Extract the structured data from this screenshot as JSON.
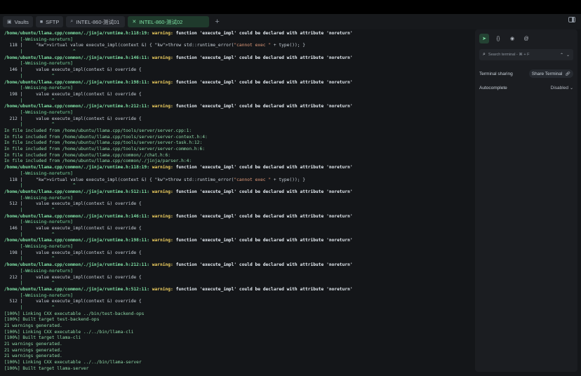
{
  "tabs": [
    {
      "icon": "vault-icon",
      "glyph": "▣",
      "label": "Vaults",
      "active": false
    },
    {
      "icon": "folder-icon",
      "glyph": "■",
      "label": "SFTP",
      "active": false
    },
    {
      "icon": "terminal-icon",
      "glyph": "⌕",
      "label": "INTEL-860-测试01",
      "active": false
    },
    {
      "icon": "close-icon",
      "glyph": "✕",
      "label": "INTEL-860-测试02",
      "active": true
    }
  ],
  "new_tab_label": "+",
  "terminal_lines": [
    {
      "type": "path",
      "pre": "/home/ubuntu/llama.cpp/common/./jinja/runtime.h:118:19: ",
      "warn": "warning:",
      "msg": " function 'execute_impl' could be declared with attribute 'noreturn'"
    },
    {
      "type": "flag",
      "text": "      [-Wmissing-noreturn]"
    },
    {
      "type": "code",
      "text": "  118 |     virtual value execute_impl(context &) { throw std::runtime_error(\"cannot exec \" + type()); }"
    },
    {
      "type": "caret",
      "text": "      |                   ^"
    },
    {
      "type": "path",
      "pre": "/home/ubuntu/llama.cpp/common/./jinja/runtime.h:146:11: ",
      "warn": "warning:",
      "msg": " function 'execute_impl' could be declared with attribute 'noreturn'"
    },
    {
      "type": "flag",
      "text": "      [-Wmissing-noreturn]"
    },
    {
      "type": "code",
      "text": "  146 |     value execute_impl(context &) override {"
    },
    {
      "type": "caret",
      "text": "      |           ^"
    },
    {
      "type": "path",
      "pre": "/home/ubuntu/llama.cpp/common/./jinja/runtime.h:198:11: ",
      "warn": "warning:",
      "msg": " function 'execute_impl' could be declared with attribute 'noreturn'"
    },
    {
      "type": "flag",
      "text": "      [-Wmissing-noreturn]"
    },
    {
      "type": "code",
      "text": "  198 |     value execute_impl(context &) override {"
    },
    {
      "type": "caret",
      "text": "      |           ^"
    },
    {
      "type": "path",
      "pre": "/home/ubuntu/llama.cpp/common/./jinja/runtime.h:212:11: ",
      "warn": "warning:",
      "msg": " function 'execute_impl' could be declared with attribute 'noreturn'"
    },
    {
      "type": "flag",
      "text": "      [-Wmissing-noreturn]"
    },
    {
      "type": "code",
      "text": "  212 |     value execute_impl(context &) override {"
    },
    {
      "type": "caret",
      "text": "      |           ^"
    },
    {
      "type": "include",
      "text": "In file included from /home/ubuntu/llama.cpp/tools/server/server.cpp:1:"
    },
    {
      "type": "include",
      "text": "In file included from /home/ubuntu/llama.cpp/tools/server/server-context.h:4:"
    },
    {
      "type": "include",
      "text": "In file included from /home/ubuntu/llama.cpp/tools/server/server-task.h:12:"
    },
    {
      "type": "include",
      "text": "In file included from /home/ubuntu/llama.cpp/tools/server/server-common.h:6:"
    },
    {
      "type": "include",
      "text": "In file included from /home/ubuntu/llama.cpp/common/./chat.h:6:"
    },
    {
      "type": "include",
      "text": "In file included from /home/ubuntu/llama.cpp/common/./jinja/parser.h:4:"
    },
    {
      "type": "path",
      "pre": "/home/ubuntu/llama.cpp/common/./jinja/runtime.h:118:19: ",
      "warn": "warning:",
      "msg": " function 'execute_impl' could be declared with attribute 'noreturn'"
    },
    {
      "type": "flag",
      "text": "      [-Wmissing-noreturn]"
    },
    {
      "type": "code",
      "text": "  118 |     virtual value execute_impl(context &) { throw std::runtime_error(\"cannot exec \" + type()); }"
    },
    {
      "type": "caret",
      "text": "      |                   ^"
    },
    {
      "type": "path",
      "pre": "/home/ubuntu/llama.cpp/common/./jinja/runtime.h:512:11: ",
      "warn": "warning:",
      "msg": " function 'execute_impl' could be declared with attribute 'noreturn'"
    },
    {
      "type": "flag",
      "text": "      [-Wmissing-noreturn]"
    },
    {
      "type": "code",
      "text": "  512 |     value execute_impl(context &) override {"
    },
    {
      "type": "caret",
      "text": "      |           ^"
    },
    {
      "type": "path",
      "pre": "/home/ubuntu/llama.cpp/common/./jinja/runtime.h:146:11: ",
      "warn": "warning:",
      "msg": " function 'execute_impl' could be declared with attribute 'noreturn'"
    },
    {
      "type": "flag",
      "text": "      [-Wmissing-noreturn]"
    },
    {
      "type": "code",
      "text": "  146 |     value execute_impl(context &) override {"
    },
    {
      "type": "caret",
      "text": "      |           ^"
    },
    {
      "type": "path",
      "pre": "/home/ubuntu/llama.cpp/common/./jinja/runtime.h:198:11: ",
      "warn": "warning:",
      "msg": " function 'execute_impl' could be declared with attribute 'noreturn'"
    },
    {
      "type": "flag",
      "text": "      [-Wmissing-noreturn]"
    },
    {
      "type": "code",
      "text": "  198 |     value execute_impl(context &) override {"
    },
    {
      "type": "caret",
      "text": "      |           ^"
    },
    {
      "type": "path",
      "pre": "/home/ubuntu/llama.cpp/common/./jinja/runtime.h:212:11: ",
      "warn": "warning:",
      "msg": " function 'execute_impl' could be declared with attribute 'noreturn'"
    },
    {
      "type": "flag",
      "text": "      [-Wmissing-noreturn]"
    },
    {
      "type": "code",
      "text": "  212 |     value execute_impl(context &) override {"
    },
    {
      "type": "caret",
      "text": "      |           ^"
    },
    {
      "type": "path",
      "pre": "/home/ubuntu/llama.cpp/common/./jinja/runtime.h:512:11: ",
      "warn": "warning:",
      "msg": " function 'execute_impl' could be declared with attribute 'noreturn'"
    },
    {
      "type": "flag",
      "text": "      [-Wmissing-noreturn]"
    },
    {
      "type": "code",
      "text": "  512 |     value execute_impl(context &) override {"
    },
    {
      "type": "caret",
      "text": "      |           ^"
    },
    {
      "type": "green",
      "text": "[100%] Linking CXX executable ../bin/test-backend-ops"
    },
    {
      "type": "green",
      "text": "[100%] Built target test-backend-ops"
    },
    {
      "type": "green",
      "text": "21 warnings generated."
    },
    {
      "type": "green",
      "text": "[100%] Linking CXX executable ../../bin/llama-cli"
    },
    {
      "type": "green",
      "text": "[100%] Built target llama-cli"
    },
    {
      "type": "green",
      "text": "21 warnings generated."
    },
    {
      "type": "green",
      "text": "21 warnings generated."
    },
    {
      "type": "green",
      "text": "21 warnings generated."
    },
    {
      "type": "green",
      "text": "[100%] Linking CXX executable ../../bin/llama-server"
    },
    {
      "type": "green",
      "text": "[100%] Built target llama-server"
    }
  ],
  "sidepanel": {
    "icons": [
      {
        "name": "send-icon",
        "glyph": "➤",
        "active": true
      },
      {
        "name": "braces-icon",
        "glyph": "{}",
        "active": false
      },
      {
        "name": "palette-icon",
        "glyph": "◉",
        "active": false
      },
      {
        "name": "at-icon",
        "glyph": "@",
        "active": false
      }
    ],
    "search_placeholder": "Search terminal - ⌘ + F",
    "search_up": "⌃",
    "search_down": "⌄",
    "terminal_sharing_label": "Terminal sharing",
    "share_button_label": "Share Terminal",
    "autocomplete_label": "Autocomplete",
    "autocomplete_value": "Disabled"
  },
  "colors": {
    "accent": "#7fe0a5",
    "warning": "#f0d060",
    "background": "#141619"
  }
}
